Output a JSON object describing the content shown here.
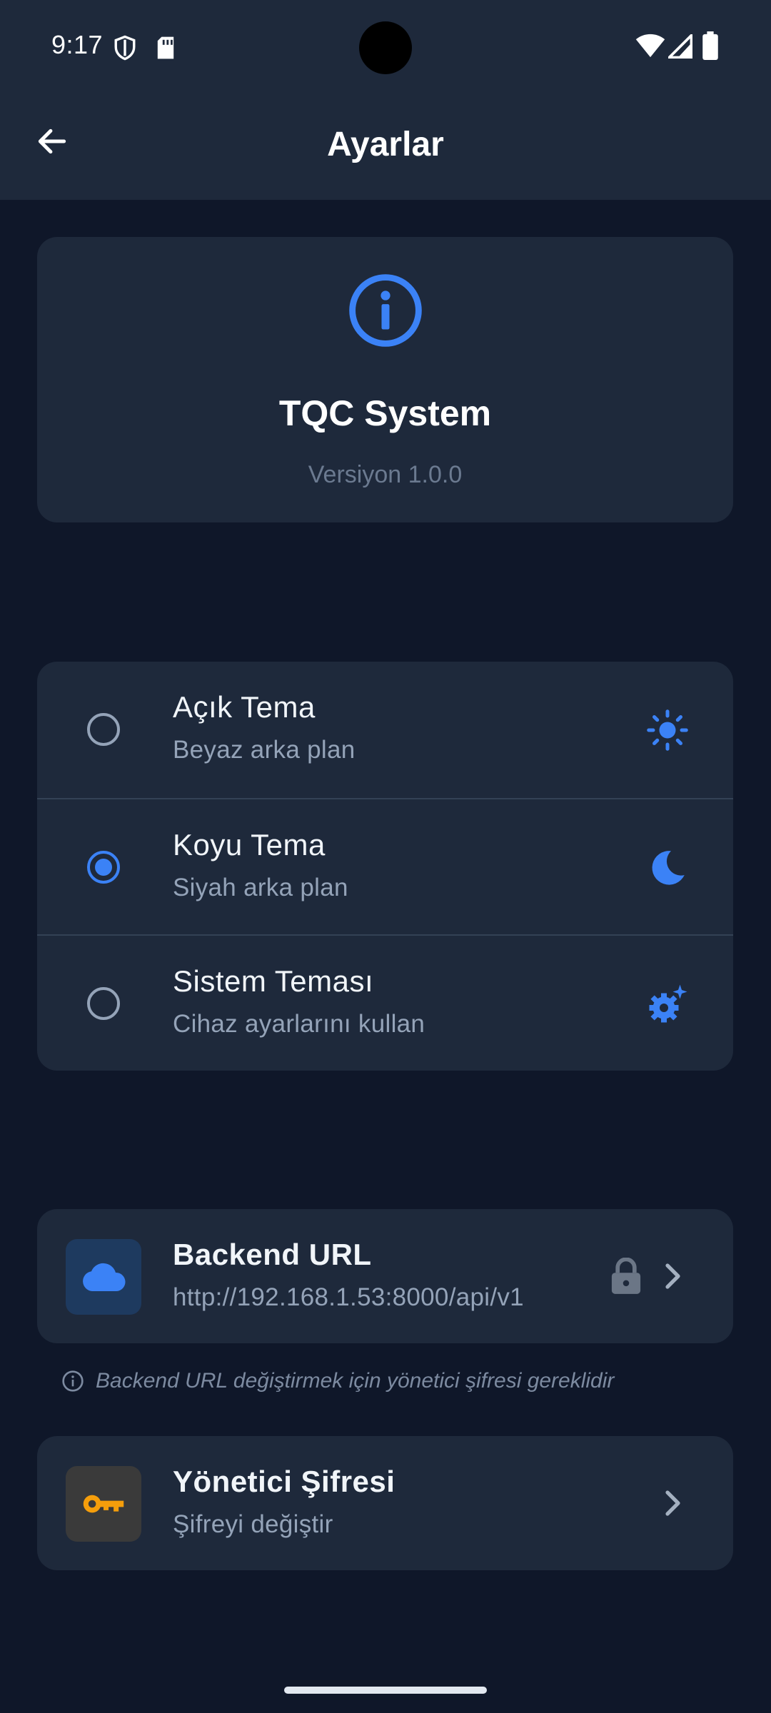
{
  "status_bar": {
    "time": "9:17"
  },
  "app_bar": {
    "title": "Ayarlar"
  },
  "app_info": {
    "name": "TQC System",
    "version": "Versiyon 1.0.0"
  },
  "themes": [
    {
      "title": "Açık Tema",
      "subtitle": "Beyaz arka plan",
      "selected": false,
      "icon": "sun-icon"
    },
    {
      "title": "Koyu Tema",
      "subtitle": "Siyah arka plan",
      "selected": true,
      "icon": "moon-icon"
    },
    {
      "title": "Sistem Teması",
      "subtitle": "Cihaz ayarlarını kullan",
      "selected": false,
      "icon": "settings-gear-icon"
    }
  ],
  "backend": {
    "title": "Backend URL",
    "url": "http://192.168.1.53:8000/api/v1",
    "hint": "Backend URL değiştirmek için yönetici şifresi gereklidir"
  },
  "admin_password": {
    "title": "Yönetici Şifresi",
    "subtitle": "Şifreyi değiştir"
  },
  "colors": {
    "background": "#0f1729",
    "surface": "#1e293b",
    "accent": "#3b82f6",
    "key_accent": "#f59e0b"
  }
}
